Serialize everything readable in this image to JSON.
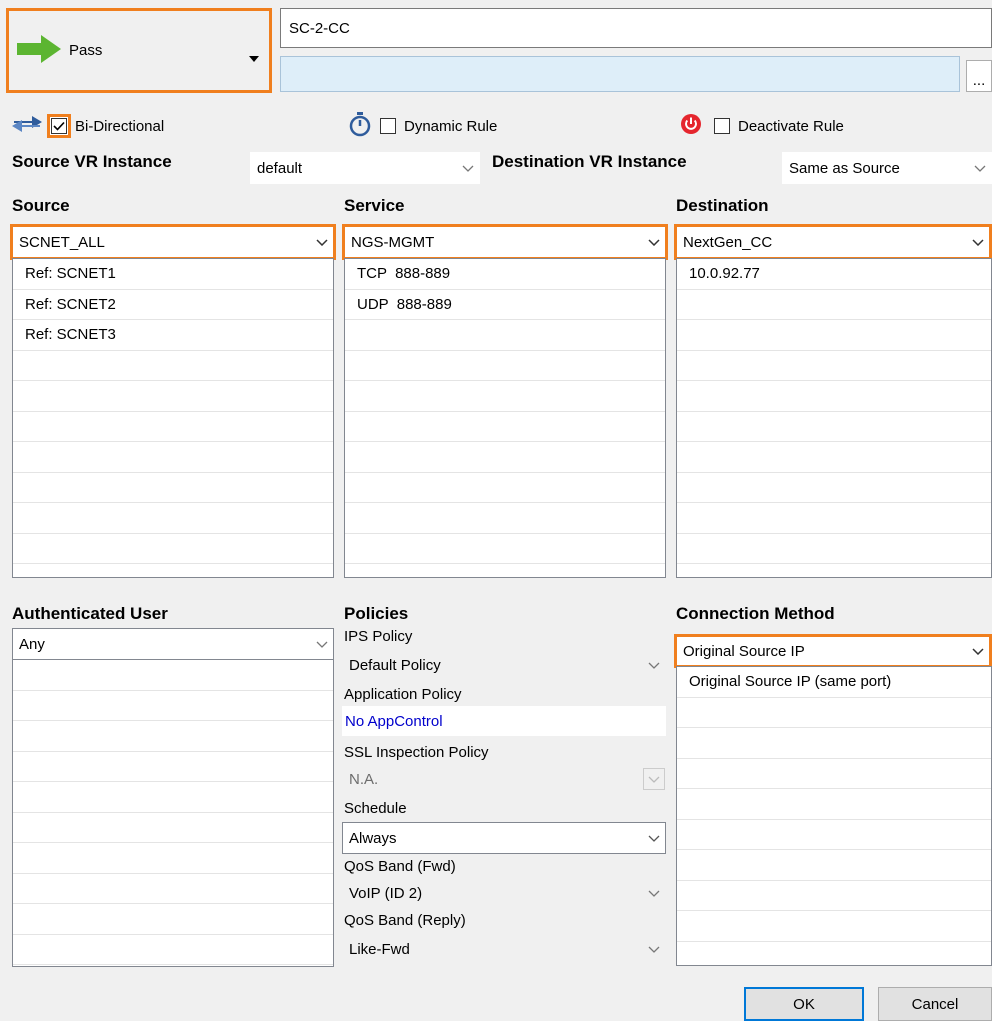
{
  "action": {
    "label": "Pass",
    "icon": "green-arrow-right-icon"
  },
  "rule_name": "SC-2-CC",
  "rule_description": "",
  "more_button": "...",
  "options": {
    "bidirectional": {
      "label": "Bi-Directional",
      "checked": true
    },
    "dynamic_rule": {
      "label": "Dynamic Rule",
      "checked": false
    },
    "deactivate_rule": {
      "label": "Deactivate Rule",
      "checked": false
    }
  },
  "vr": {
    "source_label": "Source VR Instance",
    "source_value": "default",
    "dest_label": "Destination VR Instance",
    "dest_value": "Same as Source"
  },
  "source": {
    "label": "Source",
    "selected": "SCNET_ALL",
    "items": [
      "Ref: SCNET1",
      "Ref: SCNET2",
      "Ref: SCNET3"
    ]
  },
  "service": {
    "label": "Service",
    "selected": "NGS-MGMT",
    "items": [
      "TCP  888-889",
      "UDP  888-889"
    ]
  },
  "destination": {
    "label": "Destination",
    "selected": "NextGen_CC",
    "items": [
      "10.0.92.77"
    ]
  },
  "auth_user": {
    "label": "Authenticated User",
    "selected": "Any"
  },
  "policies": {
    "label": "Policies",
    "ips_label": "IPS Policy",
    "ips_value": "Default Policy",
    "app_label": "Application Policy",
    "app_value": "No AppControl",
    "ssl_label": "SSL Inspection Policy",
    "ssl_value": "N.A.",
    "schedule_label": "Schedule",
    "schedule_value": "Always",
    "qos_fwd_label": "QoS Band (Fwd)",
    "qos_fwd_value": "VoIP (ID 2)",
    "qos_reply_label": "QoS Band (Reply)",
    "qos_reply_value": "Like-Fwd"
  },
  "connection": {
    "label": "Connection Method",
    "selected": "Original Source IP",
    "items": [
      "Original Source IP (same port)"
    ]
  },
  "buttons": {
    "ok": "OK",
    "cancel": "Cancel"
  },
  "colors": {
    "accent_highlight": "#f07f1e",
    "link_blue": "#0000cc",
    "pass_green": "#5cb531"
  }
}
